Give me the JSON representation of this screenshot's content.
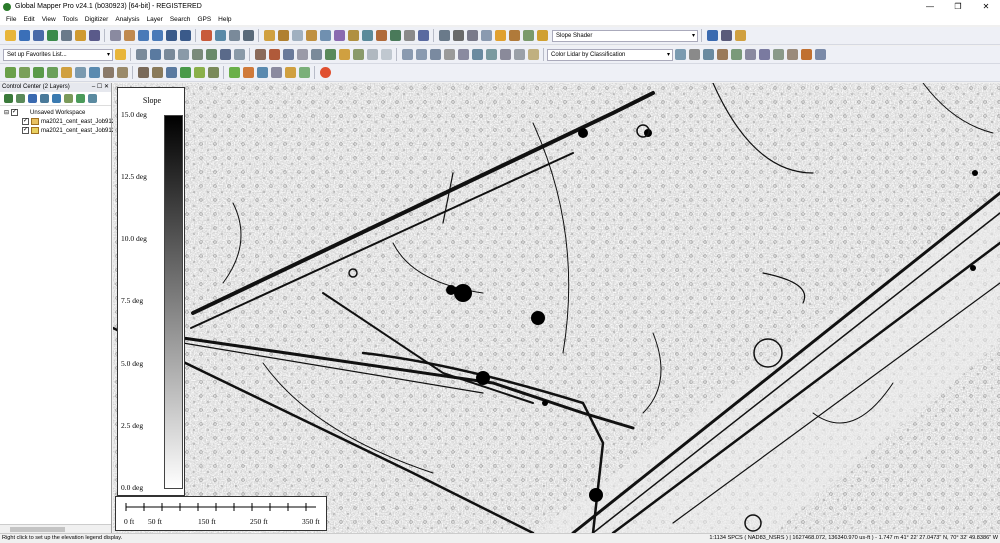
{
  "window": {
    "title": "Global Mapper Pro v24.1 (b030923) [64-bit] - REGISTERED",
    "minimize": "—",
    "maximize": "❐",
    "close": "✕"
  },
  "menu": [
    "File",
    "Edit",
    "View",
    "Tools",
    "Digitizer",
    "Analysis",
    "Layer",
    "Search",
    "GPS",
    "Help"
  ],
  "toolbar": {
    "shader_select": "Slope Shader",
    "favorites_select": "Set up Favorites List...",
    "lidar_color_select": "Color Lidar by Classification"
  },
  "control_center": {
    "title": "Control Center (2 Layers)",
    "workspace_label": "Unsaved Workspace",
    "layers": [
      "ma2021_cent_east_Job912",
      "ma2021_cent_east_Job912"
    ]
  },
  "legend": {
    "title": "Slope",
    "ticks": [
      "15.0 deg",
      "12.5 deg",
      "10.0 deg",
      "7.5 deg",
      "5.0 deg",
      "2.5 deg",
      "0.0 deg"
    ]
  },
  "scale_bar": {
    "labels": [
      "0 ft",
      "50 ft",
      "150 ft",
      "250 ft",
      "350 ft"
    ]
  },
  "status": {
    "hint": "Right click to set up the elevation legend display.",
    "info": "1:1134  SPCS ( NAD83_NSRS ) | 1627468.072, 136340.970 us-ft ) - 1.747 m  41° 22' 27.0473\" N, 70° 32' 49.8386\" W"
  },
  "colors": {
    "toolbar_bg": "#eef0f6",
    "map_bg": "#d2d2d2"
  }
}
